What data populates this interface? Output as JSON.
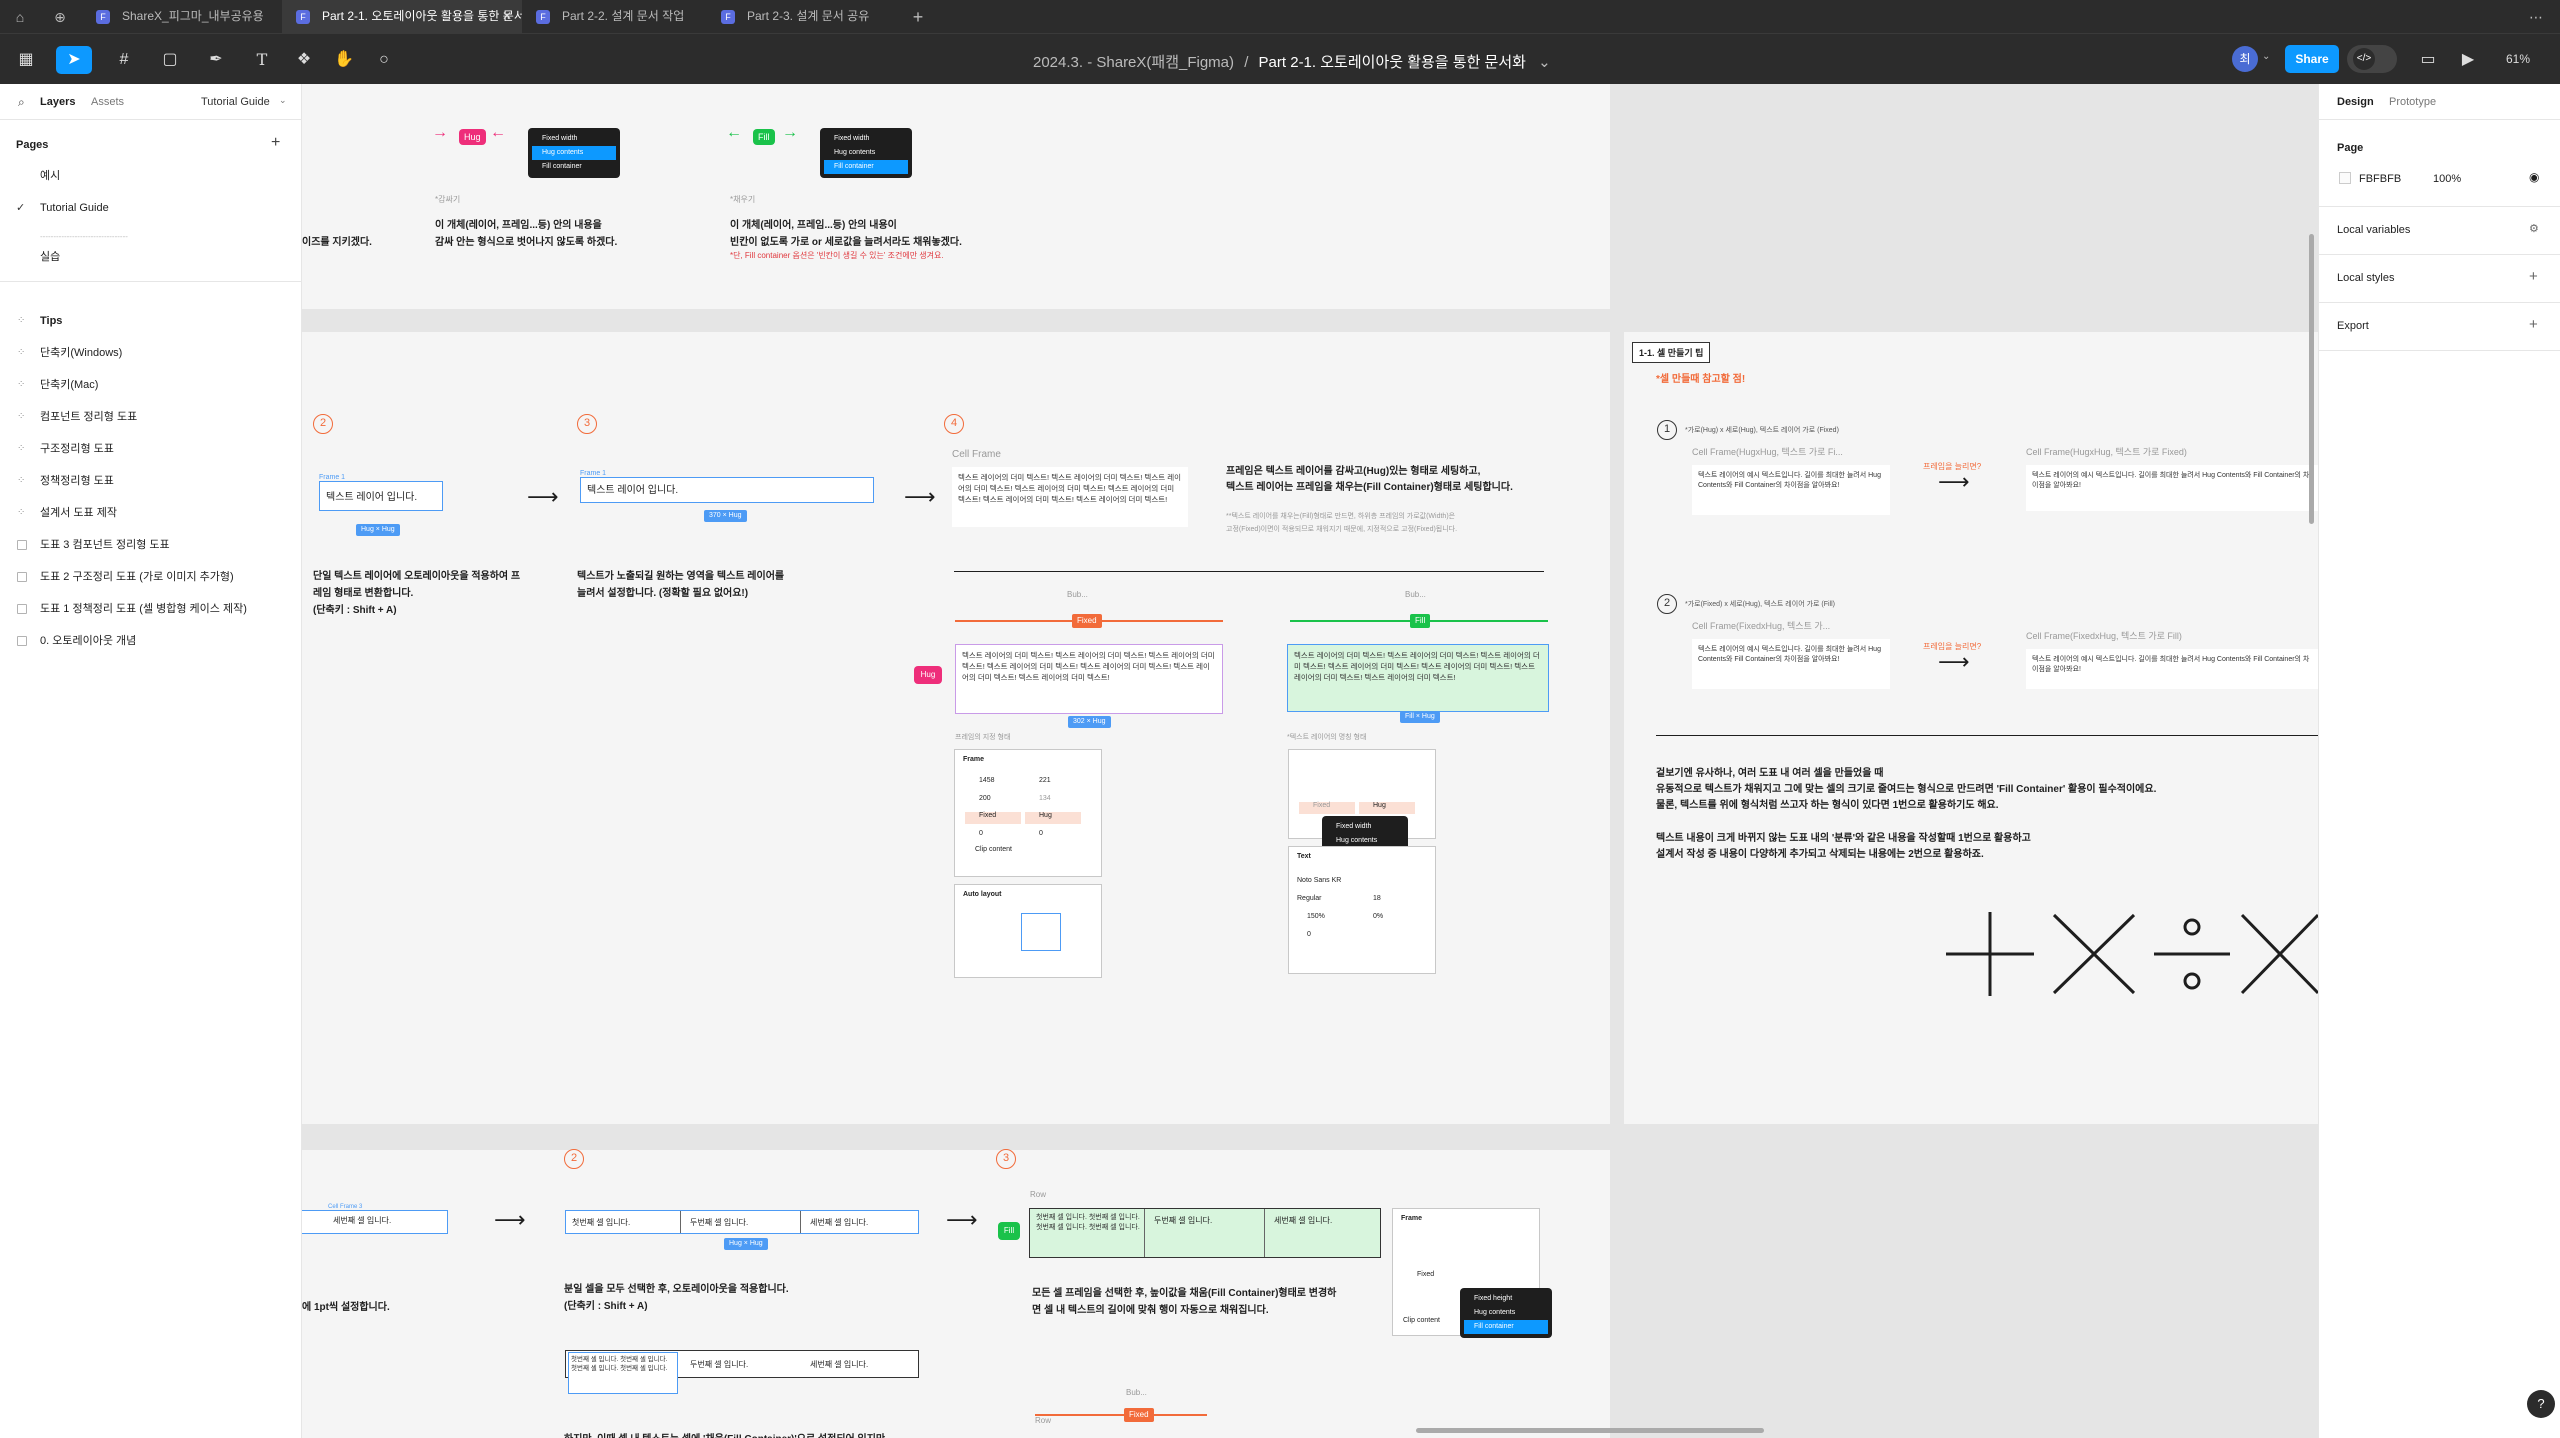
{
  "tabs": [
    {
      "label": "ShareX_피그마_내부공유용",
      "active": false
    },
    {
      "label": "Part 2-1. 오토레이아웃 활용을 통한 문서...",
      "active": true
    },
    {
      "label": "Part 2-2. 설계 문서 작업",
      "active": false
    },
    {
      "label": "Part 2-3. 설계 문서 공유",
      "active": false
    }
  ],
  "toolbar": {
    "breadcrumb_file": "2024.3. - ShareX(패캠_Figma)",
    "breadcrumb_sep": "/",
    "breadcrumb_page": "Part 2-1. 오토레이아웃 활용을 통한 문서화",
    "avatar": "최",
    "share_label": "Share",
    "zoom": "61%"
  },
  "left_panel": {
    "tabs": [
      "Layers",
      "Assets"
    ],
    "tutorial_label": "Tutorial Guide",
    "pages_title": "Pages",
    "pages": [
      {
        "label": "예시",
        "checked": false
      },
      {
        "label": "Tutorial Guide",
        "checked": true
      },
      {
        "label": "---------------------------------",
        "checked": false
      },
      {
        "label": "실습",
        "checked": false
      }
    ],
    "layers": [
      {
        "label": "Tips",
        "bold": true,
        "icon": "grid"
      },
      {
        "label": "단축키(Windows)",
        "icon": "grid"
      },
      {
        "label": "단축키(Mac)",
        "icon": "grid"
      },
      {
        "label": "컴포넌트 정리형 도표",
        "icon": "grid"
      },
      {
        "label": "구조정리형 도표",
        "icon": "grid"
      },
      {
        "label": "정책정리형 도표",
        "icon": "grid"
      },
      {
        "label": "설계서 도표 제작",
        "icon": "grid"
      },
      {
        "label": "도표 3 컴포넌트 정리형 도표",
        "icon": "frame"
      },
      {
        "label": "도표 2 구조정리 도표 (가로 이미지 추가형)",
        "icon": "frame"
      },
      {
        "label": "도표 1 정책정리 도표 (셀 병합형 케이스 제작)",
        "icon": "frame"
      },
      {
        "label": "0. 오토레이아웃 개념",
        "icon": "frame"
      }
    ]
  },
  "right_panel": {
    "tabs": [
      "Design",
      "Prototype"
    ],
    "page_title": "Page",
    "page_color": "FBFBFB",
    "page_opacity": "100%",
    "sections": [
      "Local variables",
      "Local styles",
      "Export"
    ]
  },
  "canvas": {
    "top": {
      "hug_label": "Hug",
      "fill_label": "Fill",
      "menu": [
        "Fixed width",
        "Hug contents",
        "Fill container"
      ],
      "caption_hug": "*감싸기",
      "caption_fill": "*채우기",
      "left_cut": "이즈를 지키겠다.",
      "hug_desc1": "이 개체(레이어, 프레임...등) 안의 내용을",
      "hug_desc2": "감싸 안는 형식으로 벗어나지 않도록 하겠다.",
      "fill_desc1": "이 개체(레이어, 프레임...등) 안의 내용이",
      "fill_desc2": "빈칸이 없도록 가로 or 세로값을 늘려서라도 채워놓겠다.",
      "fill_note": "*단, Fill container 옵션은 '빈칸이 생길 수 있는' 조건에만 생겨요."
    },
    "mid": {
      "step2": "2",
      "step3": "3",
      "step4": "4",
      "frame_label": "Frame 1",
      "text_layer": "텍스트 레이어 입니다.",
      "chip_hughug": "Hug × Hug",
      "chip_fixed_hug": "370 × Hug",
      "desc2_1": "단일 텍스트 레이어에 오토레이아웃을 적용하여 프",
      "desc2_2": "레임 형태로 변환합니다.",
      "desc2_3": "(단축키 : Shift + A)",
      "desc3_1": "텍스트가 노출되길 원하는 영역을 텍스트 레이어를",
      "desc3_2": "늘려서 설정합니다. (정확할 필요 없어요!)",
      "cell_frame": "Cell Frame",
      "long_text": "텍스트 레이어의 더미 텍스트! 텍스트 레이어의 더미 텍스트! 텍스트 레이어의 더미 텍스트! 텍스트 레이어의 더미 텍스트! 텍스트 레이어의 더미 텍스트! 텍스트 레이어의 더미 텍스트! 텍스트 레이어의 더미 텍스트!",
      "desc4_1": "프레임은 텍스트 레이어를 감싸고(Hug)있는 형태로 세팅하고,",
      "desc4_2": "텍스트 레이어는 프레임을 채우는(Fill Container)형태로 세팅합니다.",
      "desc4_note1": "**텍스트 레이어를 채우는(Fill)형태로 만드면, 하위층 프레임의 가로값(Width)은",
      "desc4_note2": "고정(Fixed)이면이 적용되므로 채워지기 때문에, 지정적으로 고정(Fixed)됩니다.",
      "fixed_chip": "Fixed",
      "fill_chip": "Fill",
      "hug_chip": "Hug",
      "sub_frame": "프레임의 지정 형태",
      "sub_text": "*텍스트 레이어의 명칭 형태",
      "prop_frame_title": "Frame",
      "prop_al_title": "Auto layout",
      "prop_text_title": "Text",
      "prop_font": "Noto Sans KR",
      "prop_weight": "Regular",
      "prop_size": "18",
      "v_1458": "1458",
      "v_221": "221",
      "v_200": "200",
      "v_134": "134",
      "v_fixed": "Fixed",
      "v_hug": "Hug",
      "v_0": "0",
      "v_clip": "Clip content",
      "v_150": "150%",
      "v_0pct": "0%",
      "chip_3b2": "302 × Hug",
      "chip_fillhug": "Fill × Hug"
    },
    "tips": {
      "title": "1-1. 셀 만들기 팁",
      "subtitle": "*셀 만들때 참고할 점!",
      "n1": "1",
      "n2": "2",
      "case1": "*가로(Hug) x 세로(Hug), 텍스트 레이어 가로 (Fixed)",
      "case2": "*가로(Fixed) x 세로(Hug), 텍스트 레이어 가로 (Fill)",
      "cf1a": "Cell Frame(HugxHug, 텍스트 가로 Fi...",
      "cf1b": "Cell Frame(HugxHug, 텍스트 가로 Fixed)",
      "cf2a": "Cell Frame(FixedxHug, 텍스트 가...",
      "cf2b": "Cell Frame(FixedxHug, 텍스트 가로 Fill)",
      "q": "프레임을 늘리면?",
      "card1a": "텍스트 레이어의 예시 텍스트입니다. 길이를 최대한 늘려서 Hug Contents와 Fill Container의 차이점을 알아봐요!",
      "card1b": "텍스트 레이어의 예시 텍스트입니다. 길이를 최대한 늘려서 Hug Contents와 Fill Container의 차이점을 알아봐요!",
      "card2a": "텍스트 레이어의 예시 텍스트입니다. 길이를 최대한 늘려서 Hug Contents와 Fill Container의 차이점을 알아봐요!",
      "card2b": "텍스트 레이어의 예시 텍스트입니다. 길이를 최대한 늘려서 Hug Contents와 Fill Container의 차이점을 알아봐요!",
      "p1": "겉보기엔 유사하나, 여러 도표 내 여러 셀을 만들었을 때",
      "p2": "유동적으로 텍스트가 채워지고 그에 맞는 셀의 크기로 줄여드는 형식으로 만드려면 'Fill Container' 활용이 필수적이에요.",
      "p3": "물론, 텍스트를 위에 형식처럼 쓰고자 하는 형식이 있다면 1번으로 활용하기도 해요.",
      "p4": "텍스트 내용이 크게 바뀌지 않는 도표 내의 '분류'와 같은 내용을 작성할때 1번으로 활용하고",
      "p5": "설계서 작성 중 내용이 다양하게 추가되고 삭제되는 내용에는 2번으로 활용하죠."
    },
    "bottom": {
      "step2": "2",
      "step3": "3",
      "cell_frame3": "Cell Frame 3",
      "cell1": "첫번째 셀 입니다.",
      "cell2": "두번째 셀 입니다.",
      "cell3": "세번째 셀 입니다.",
      "cell_left": "세번째 셀 입니다.",
      "row": "Row",
      "fill_chip": "Fill",
      "fixed_chip": "Fixed",
      "hughug": "Hug × Hug",
      "long_cell": "첫번째 셀 입니다. 첫번째 셀 입니다. 첫번째 셀 입니다. 첫번째 셀 입니다.",
      "desc_left": "에 1pt씩 설정합니다.",
      "desc2_1": "분일 셀을 모두 선택한 후, 오토레이아웃을 적용합니다.",
      "desc2_2": "(단축키 : Shift + A)",
      "desc3_1": "모든 셀 프레임을 선택한 후, 높이값을 채움(Fill Container)형태로 변경하",
      "desc3_2": "면 셀 내 텍스트의 길이에 맞춰 행이 자동으로 채워집니다.",
      "desc_bottom": "하지만, 이때 셀 내 텍스트는 셀에 '채움(Fill Container)'으로 설정되어 있지만",
      "menu2": [
        "Fixed height",
        "Hug contents",
        "Fill container"
      ],
      "bub": "Bub..."
    },
    "math_symbols": "plus-times-divide-times"
  }
}
